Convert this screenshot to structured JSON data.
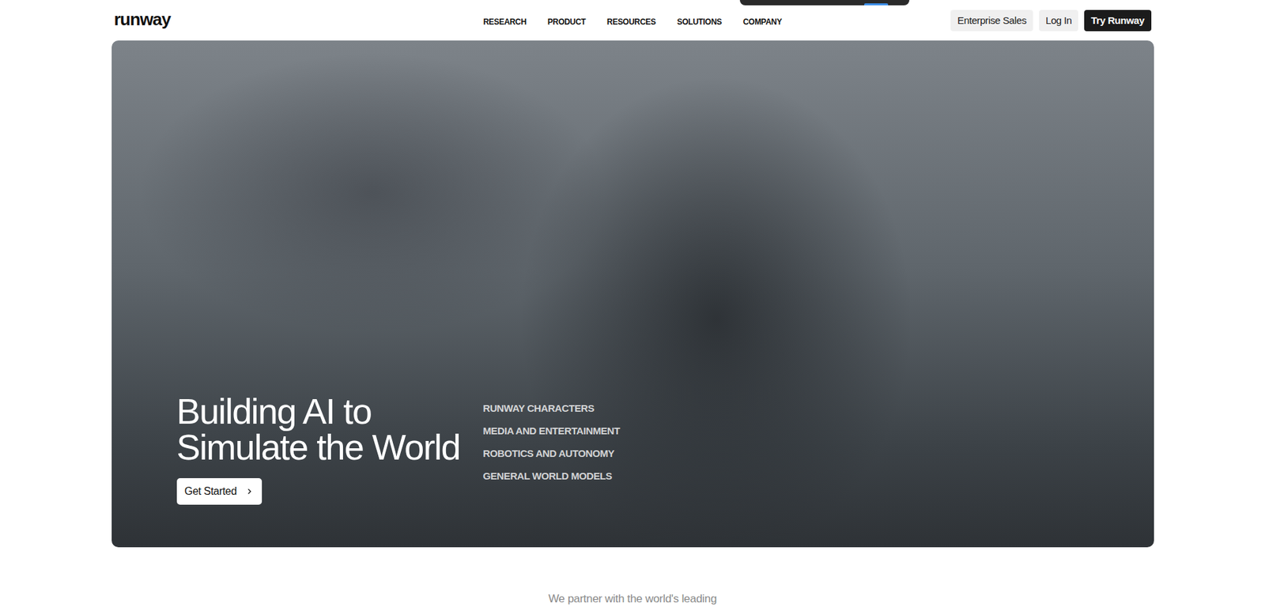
{
  "header": {
    "logo": "runway",
    "nav": [
      "RESEARCH",
      "PRODUCT",
      "RESOURCES",
      "SOLUTIONS",
      "COMPANY"
    ],
    "buttons": [
      {
        "label": "Enterprise Sales",
        "kind": "light"
      },
      {
        "label": "Log In",
        "kind": "light"
      },
      {
        "label": "Try Runway",
        "kind": "dark"
      }
    ]
  },
  "hero": {
    "title_lines": [
      "Building AI to",
      "Simulate the World"
    ],
    "cta": "Get Started",
    "solutions": [
      "RUNWAY CHARACTERS",
      "MEDIA AND ENTERTAINMENT",
      "ROBOTICS AND AUTONOMY",
      "GENERAL WORLD MODELS"
    ]
  },
  "partners": {
    "text": "We partner with the world's leading"
  }
}
